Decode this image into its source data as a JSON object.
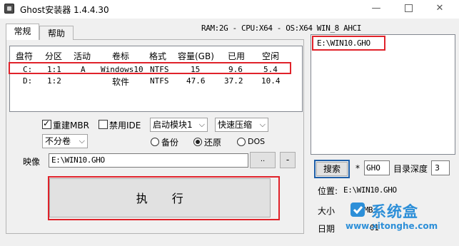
{
  "window": {
    "title": "Ghost安装器 1.4.4.30"
  },
  "sysinfo": "RAM:2G - CPU:X64 - OS:X64 WIN_8 AHCI",
  "tabs": [
    {
      "label": "常规"
    },
    {
      "label": "帮助"
    }
  ],
  "partition_table": {
    "columns": [
      "盘符",
      "分区",
      "活动",
      "卷标",
      "格式",
      "容量(GB)",
      "已用",
      "空闲"
    ],
    "rows": [
      [
        "C:",
        "1:1",
        "A",
        "Windows10",
        "NTFS",
        "15",
        "9.6",
        "5.4"
      ],
      [
        "D:",
        "1:2",
        "",
        "软件",
        "NTFS",
        "47.6",
        "37.2",
        "10.4"
      ]
    ],
    "selected_row": 0
  },
  "options": {
    "rebuild_mbr": {
      "label": "重建MBR",
      "checked": true
    },
    "disable_ide": {
      "label": "禁用IDE",
      "checked": false
    },
    "boot_module": "启动模块1",
    "compression": "快速压缩",
    "split_volume": "不分卷",
    "mode_backup": "备份",
    "mode_restore": "还原",
    "mode_dos": "DOS",
    "selected_mode": "还原"
  },
  "image": {
    "label": "映像",
    "path": "E:\\WIN10.GHO",
    "browse_label": "..",
    "minus_label": "-"
  },
  "execute_label": "执      行",
  "right_panel": {
    "file_list": [
      "E:\\WIN10.GHO"
    ],
    "search_label": "搜索",
    "star": "*",
    "ext": "GHO",
    "depth_label": "目录深度",
    "depth": "3",
    "location_label": "位置:",
    "location_value": "E:\\WIN10.GHO",
    "size_label": "大小",
    "size_value": "78 MB",
    "date_label": "日期",
    "date_value": "01"
  },
  "watermark": {
    "brand": "系统盒",
    "url": "www.xitonghe.com"
  },
  "colors": {
    "highlight": "#e0222a",
    "focus": "#1f5fa8",
    "watermark": "#2d8fd8"
  }
}
